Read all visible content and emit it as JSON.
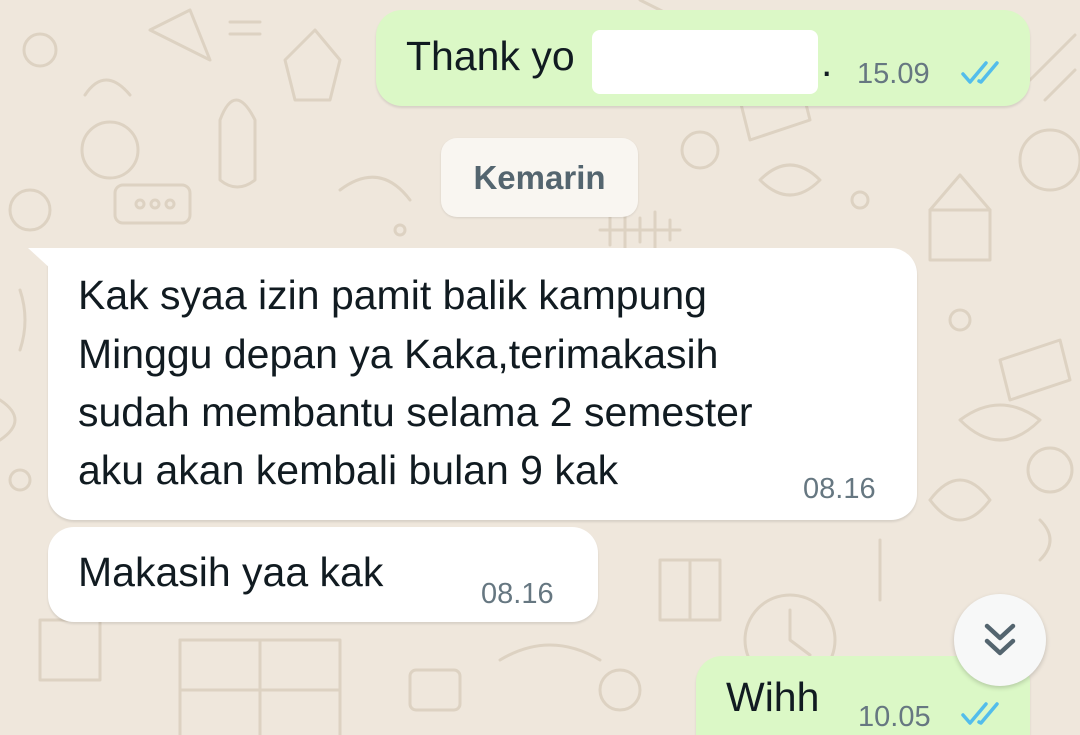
{
  "chat": {
    "messages": [
      {
        "direction": "outgoing",
        "text": "Thank yo",
        "text_suffix": ".",
        "time": "15.09",
        "status": "read"
      },
      {
        "direction": "incoming",
        "lines": [
          "Kak syaa izin pamit balik kampung",
          "Minggu depan ya Kaka,terimakasih",
          "sudah membantu selama 2 semester",
          "aku akan kembali bulan 9 kak"
        ],
        "time": "08.16"
      },
      {
        "direction": "incoming",
        "text": "Makasih yaa kak",
        "time": "08.16"
      },
      {
        "direction": "outgoing",
        "text": "Wihh",
        "time": "10.05",
        "status": "read"
      }
    ],
    "date_divider": "Kemarin"
  },
  "scroll_button": {
    "icon": "double-chevron-down-icon"
  },
  "colors": {
    "outgoing_bubble": "#dbf8c6",
    "incoming_bubble": "#ffffff",
    "read_ticks": "#53bdeb",
    "wallpaper": "#efe7dc"
  }
}
